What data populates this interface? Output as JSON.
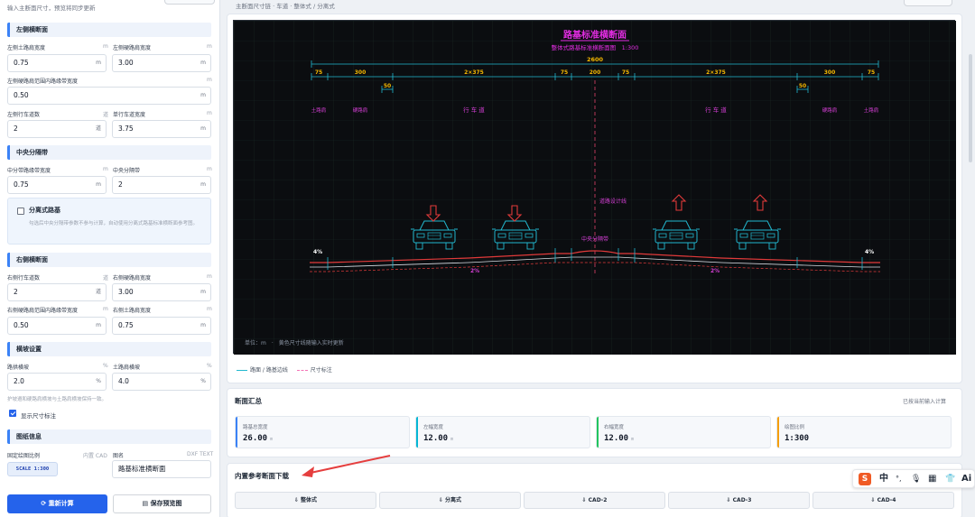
{
  "left": {
    "hint": "输入主断面尺寸，预览将同步更新",
    "left_section": {
      "title": "左侧横断面",
      "fields": [
        {
          "label": "左侧土路肩宽度",
          "unit": "m",
          "value": "0.75"
        },
        {
          "label": "左侧硬路肩宽度",
          "unit": "m",
          "value": "3.00"
        },
        {
          "label": "左侧硬路肩范围内路缘带宽度",
          "unit": "m",
          "value": "0.50"
        },
        {
          "label": "左侧行车道数",
          "unit": "道",
          "value": "2"
        },
        {
          "label": "单行车道宽度",
          "unit": "m",
          "value": "3.75"
        }
      ]
    },
    "median": {
      "title": "中央分隔带",
      "fields": [
        {
          "label": "中分带路缘带宽度",
          "unit": "m",
          "value": "0.75"
        },
        {
          "label": "中央分隔带",
          "unit": "m",
          "value": "2"
        }
      ],
      "separate_title": "分离式路基",
      "separate_desc": "勾选后中央分隔带参数不参与计算，自动使用分离式路基标准横断面参考图。"
    },
    "right_section": {
      "title": "右侧横断面",
      "fields": [
        {
          "label": "右侧行车道数",
          "unit": "道",
          "value": "2"
        },
        {
          "label": "右侧硬路肩宽度",
          "unit": "m",
          "value": "3.00"
        },
        {
          "label": "右侧硬路肩范围内路缘带宽度",
          "unit": "m",
          "value": "0.50"
        },
        {
          "label": "右侧土路肩宽度",
          "unit": "m",
          "value": "0.75"
        }
      ]
    },
    "slope": {
      "title": "横坡设置",
      "fields": [
        {
          "label": "路拱横坡",
          "unit": "%",
          "value": "2.0"
        },
        {
          "label": "土路肩横坡",
          "unit": "%",
          "value": "4.0"
        }
      ],
      "note": "护坡遵和硬路肩横坡与土路肩横坡保持一致。",
      "show_dims": "显示尺寸标注"
    },
    "drawing": {
      "title": "图纸信息",
      "scale_label": "固定绘图比例",
      "scale_tag": "内置 CAD",
      "scale_value": "SCALE 1:300",
      "name_label": "图名",
      "name_tag": "DXF TEXT",
      "name_value": "路基标准横断面"
    },
    "btn_recalc": "⟳ 重新计算",
    "btn_save": "▤ 保存预览图"
  },
  "breadcrumb": "主断面尺寸链 · 车道 · 整体式 / 分离式",
  "drawing": {
    "title": "路基标准横断面",
    "subtitle": "整体式路基标准横断面图　1:300",
    "total": "2600",
    "dims": [
      "75",
      "300",
      "2×375",
      "75",
      "200",
      "75",
      "2×375",
      "300",
      "75"
    ],
    "sub_dims": [
      "50",
      "50"
    ],
    "zone_labels": [
      "土路肩",
      "硬路肩",
      "行 车 道",
      "行 车 道",
      "硬路肩",
      "土路肩"
    ],
    "centerline_label": "道路设计线",
    "median_label": "中央分隔带",
    "slopes": [
      "4%",
      "2%",
      "2%",
      "4%"
    ],
    "footer": "单位：m　·　黄色尺寸线随输入实时更新"
  },
  "legend": {
    "a": "路面 / 路基边线",
    "b": "尺寸标注"
  },
  "summary": {
    "title": "断面汇总",
    "note": "已按当前输入计算",
    "items": [
      {
        "label": "路基总宽度",
        "value": "26.00",
        "unit": "m",
        "color": "#3b82f6"
      },
      {
        "label": "左幅宽度",
        "value": "12.00",
        "unit": "m",
        "color": "#06b6d4"
      },
      {
        "label": "右幅宽度",
        "value": "12.00",
        "unit": "m",
        "color": "#22c55e"
      },
      {
        "label": "绘图比例",
        "value": "1:300",
        "unit": "",
        "color": "#f59e0b"
      }
    ]
  },
  "downloads": {
    "title": "内置参考断面下载",
    "items": [
      "⇩ 整体式",
      "⇩ 分离式",
      "⇩ CAD-2",
      "⇩ CAD-3",
      "⇩ CAD-4"
    ]
  },
  "ime": {
    "logo": "S",
    "lang": "中",
    "punct": "°,",
    "mic": "🎙",
    "kbd": "▦",
    "skin": "👕",
    "ai": "Ai"
  }
}
